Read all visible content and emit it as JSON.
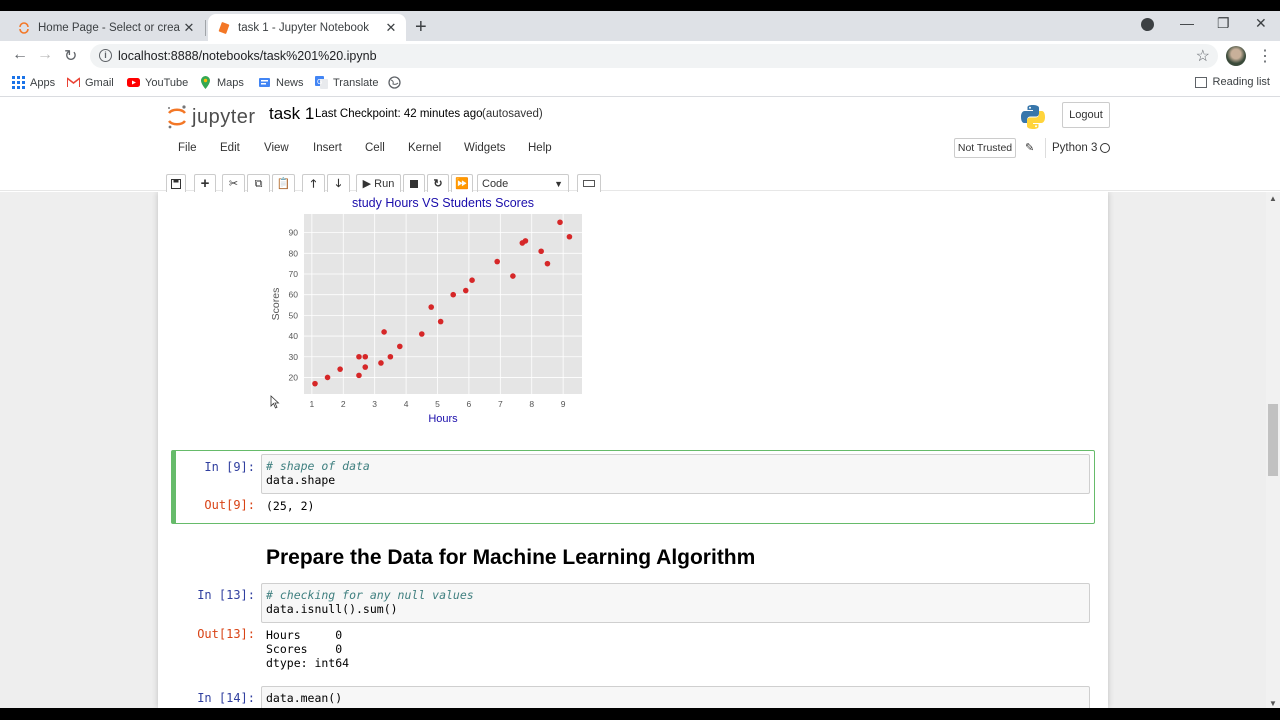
{
  "browser": {
    "tabs": [
      {
        "title": "Home Page - Select or create a n",
        "active": false
      },
      {
        "title": "task 1 - Jupyter Notebook",
        "active": true
      }
    ],
    "url": "localhost:8888/notebooks/task%201%20.ipynb",
    "bookmarks": [
      "Apps",
      "Gmail",
      "YouTube",
      "Maps",
      "News",
      "Translate"
    ],
    "reading_list": "Reading list"
  },
  "jupyter": {
    "logo_text": "jupyter",
    "notebook_name": "task 1",
    "checkpoint": "Last Checkpoint: 42 minutes ago",
    "autosave": "(autosaved)",
    "logout": "Logout",
    "menu": [
      "File",
      "Edit",
      "View",
      "Insert",
      "Cell",
      "Kernel",
      "Widgets",
      "Help"
    ],
    "trust": "Not Trusted",
    "kernel": "Python 3",
    "run_label": "Run",
    "cell_type": "Code"
  },
  "cells": {
    "c9": {
      "in_prompt": "In [9]:",
      "line1": "# shape of data",
      "line2": "data.shape",
      "out_prompt": "Out[9]:",
      "output": "(25, 2)"
    },
    "heading": "Prepare the Data for Machine Learning Algorithm",
    "c13": {
      "in_prompt": "In [13]:",
      "line1": "# checking for any null values",
      "line2": "data.isnull().sum()",
      "out_prompt": "Out[13]:",
      "out1": "Hours     0",
      "out2": "Scores    0",
      "out3": "dtype: int64"
    },
    "c14": {
      "in_prompt": "In [14]:",
      "line1": "data.mean()"
    }
  },
  "chart_data": {
    "type": "scatter",
    "title": "study Hours VS Students Scores",
    "xlabel": "Hours",
    "ylabel": "Scores",
    "xlim": [
      0.75,
      9.6
    ],
    "ylim": [
      12,
      99
    ],
    "xticks": [
      1,
      2,
      3,
      4,
      5,
      6,
      7,
      8,
      9
    ],
    "yticks": [
      20,
      30,
      40,
      50,
      60,
      70,
      80,
      90
    ],
    "grid": true,
    "background": "#e5e5e5",
    "point_color": "#d62728",
    "title_color": "#1a0dab",
    "x": [
      2.5,
      5.1,
      3.2,
      8.5,
      3.5,
      1.5,
      9.2,
      5.5,
      8.3,
      2.7,
      7.7,
      5.9,
      4.5,
      3.3,
      1.1,
      8.9,
      2.5,
      1.9,
      6.1,
      7.4,
      2.7,
      4.8,
      3.8,
      6.9,
      7.8
    ],
    "y": [
      21,
      47,
      27,
      75,
      30,
      20,
      88,
      60,
      81,
      25,
      85,
      62,
      41,
      42,
      17,
      95,
      30,
      24,
      67,
      69,
      30,
      54,
      35,
      76,
      86
    ]
  }
}
